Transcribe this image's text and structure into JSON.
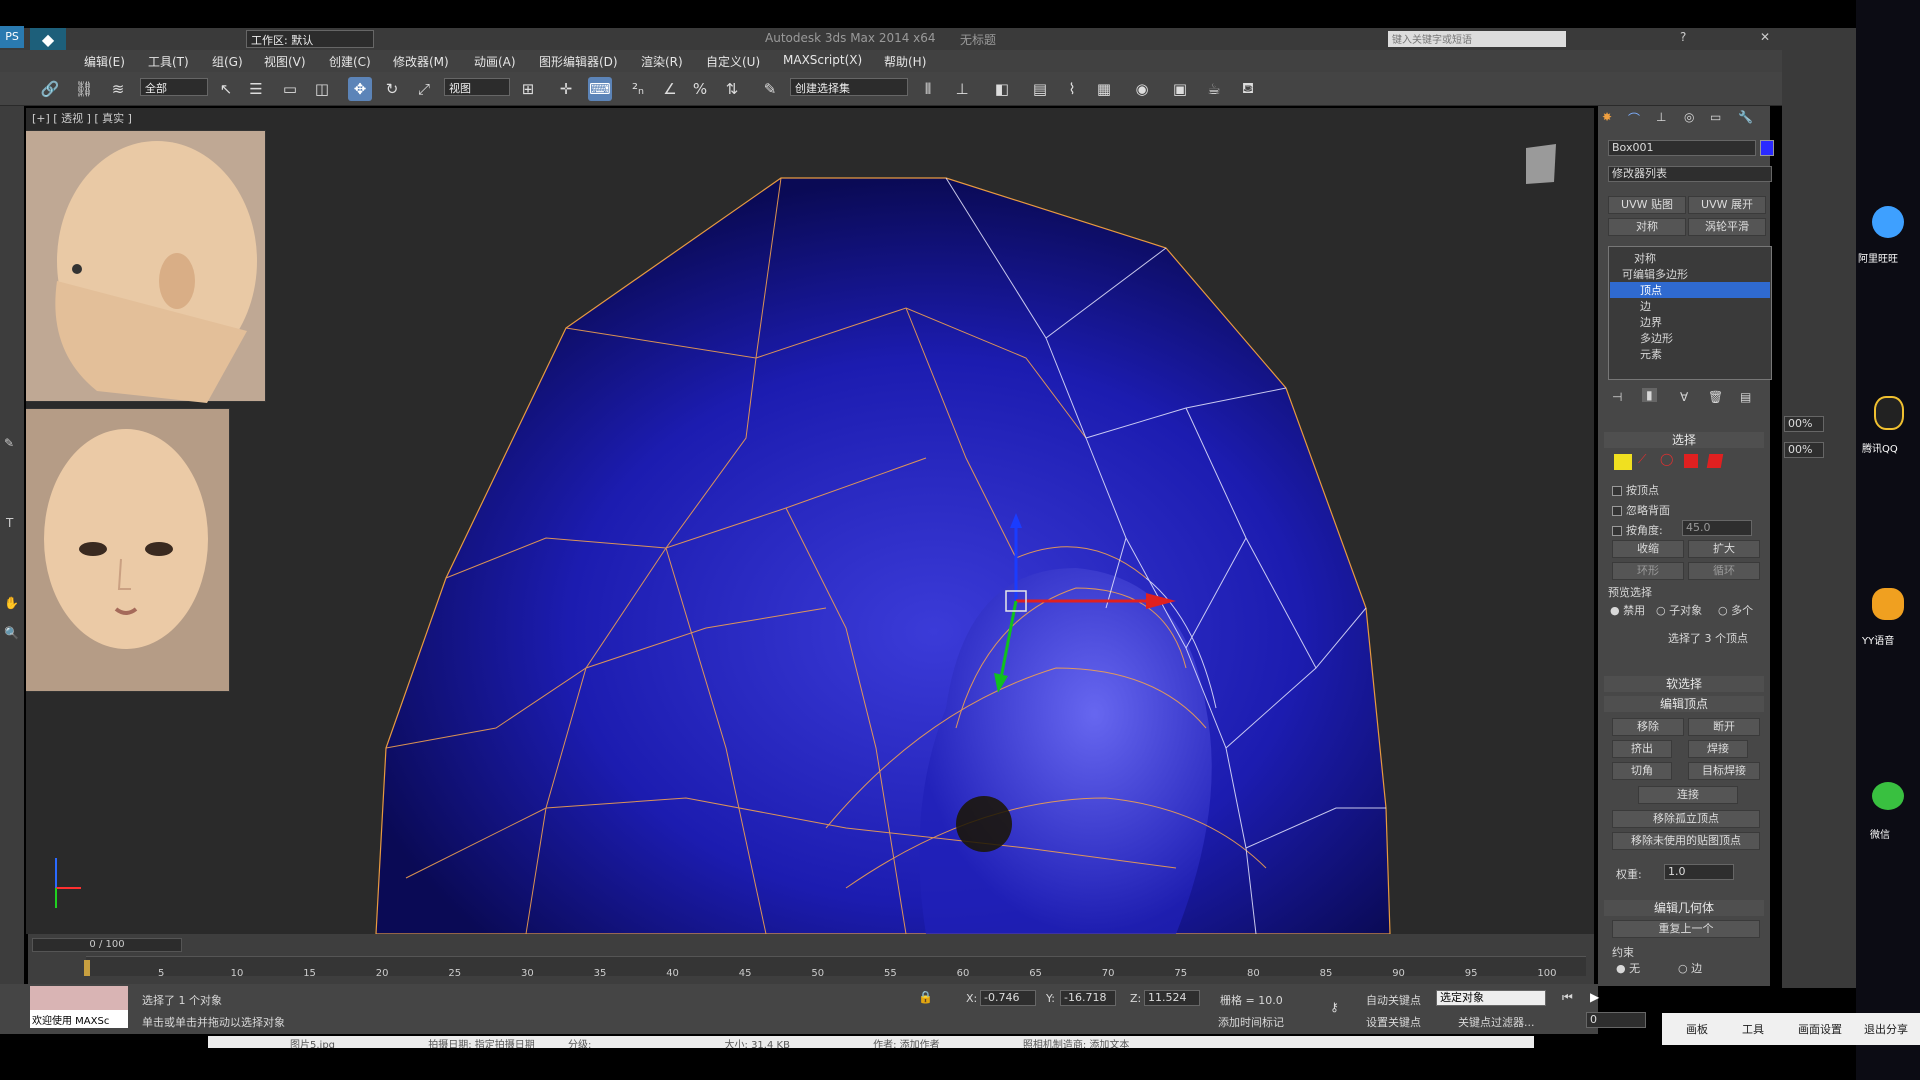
{
  "window": {
    "title": "Autodesk 3ds Max  2014 x64",
    "doc": "无标题",
    "search_placeholder": "键入关键字或短语",
    "workspace": "工作区: 默认"
  },
  "menu": [
    "编辑(E)",
    "工具(T)",
    "组(G)",
    "视图(V)",
    "创建(C)",
    "修改器(M)",
    "动画(A)",
    "图形编辑器(D)",
    "渲染(R)",
    "自定义(U)",
    "MAXScript(X)",
    "帮助(H)"
  ],
  "toolbar": {
    "filter": "全部",
    "refcoord": "视图",
    "selset_placeholder": "创建选择集"
  },
  "viewport": {
    "label": "[+] [ 透视 ] [ 真实 ]"
  },
  "panel": {
    "object_name": "Box001",
    "modifier_list": "修改器列表",
    "buttons": [
      "UVW 贴图",
      "UVW 展开",
      "对称",
      "涡轮平滑"
    ],
    "stack": [
      "对称",
      "可编辑多边形",
      "顶点",
      "边",
      "边界",
      "多边形",
      "元素"
    ],
    "rollout_select": "选择",
    "by_vertex": "按顶点",
    "ignore_back": "忽略背面",
    "by_angle": "按角度:",
    "angle_val": "45.0",
    "shrink": "收缩",
    "grow": "扩大",
    "ring": "环形",
    "loop": "循环",
    "preview_sel": "预览选择",
    "preview_opts": [
      "禁用",
      "子对象",
      "多个"
    ],
    "selected_info": "选择了 3 个顶点",
    "soft_sel": "软选择",
    "edit_vertex": "编辑顶点",
    "edit_buttons": [
      "移除",
      "断开",
      "挤出",
      "焊接",
      "切角",
      "目标焊接"
    ],
    "connect": "连接",
    "remove_iso": "移除孤立顶点",
    "remove_unused": "移除未使用的贴图顶点",
    "weight_label": "权重:",
    "weight_val": "1.0",
    "edit_geom": "编辑几何体",
    "repeat_last": "重复上一个",
    "constraint": "约束",
    "constraint_opts": [
      "无",
      "边"
    ]
  },
  "timeline": {
    "frame": "0 / 100",
    "ticks": [
      "5",
      "10",
      "15",
      "20",
      "25",
      "30",
      "35",
      "40",
      "45",
      "50",
      "55",
      "60",
      "65",
      "70",
      "75",
      "80",
      "85",
      "90",
      "95",
      "100"
    ]
  },
  "status": {
    "welcome": "欢迎使用 MAXSc",
    "selected_objects": "选择了 1 个对象",
    "hint": "单击或单击并拖动以选择对象",
    "x": "-0.746",
    "y": "-16.718",
    "z": "11.524",
    "grid": "栅格 = 10.0",
    "autokey": "自动关键点",
    "set_key": "设置关键点",
    "sel_obj": "选定对象",
    "key_filters": "关键点过滤器...",
    "add_tag": "添加时间标记",
    "frame_field": "0"
  },
  "bottom_taskbar": [
    "画板",
    "工具",
    "画面设置",
    "退出分享"
  ],
  "desktop_icons": [
    "阿里旺旺",
    "腾讯QQ",
    "YY语音",
    "微信"
  ],
  "image_bar": {
    "name": "图片5.jpg",
    "shot_date": "拍摄日期: 指定拍摄日期",
    "rating": "分级:",
    "size": "大小: 31.4 KB",
    "author": "作者: 添加作者",
    "camera": "照相机制造商: 添加文本"
  },
  "far_right": {
    "pct1": "00%",
    "pct2": "00%"
  }
}
